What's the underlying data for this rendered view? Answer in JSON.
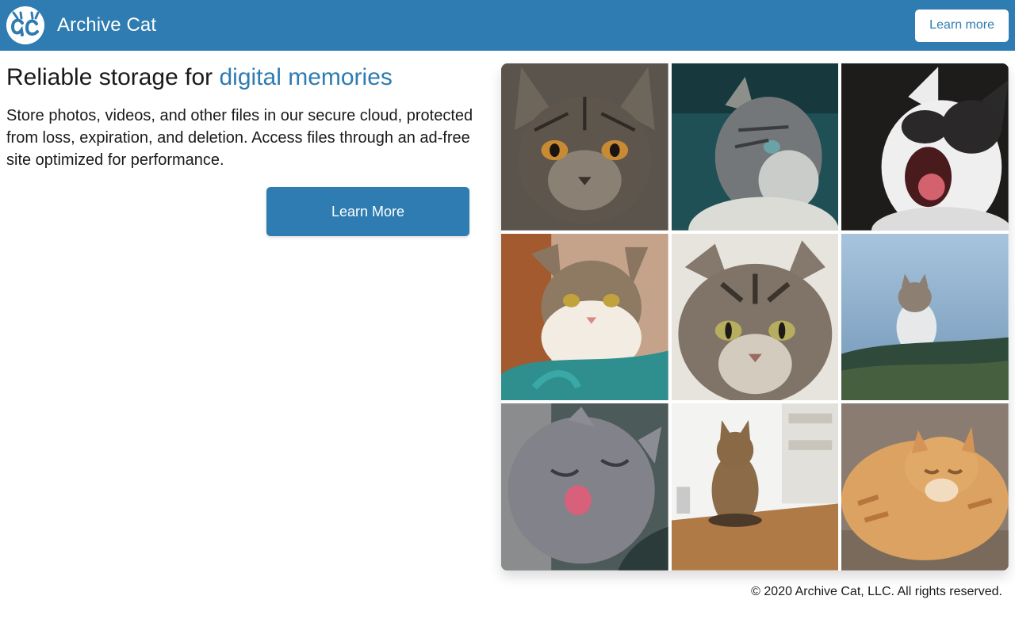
{
  "brand": {
    "name": "Archive Cat",
    "logo_icon": "archive-cat-logo-icon"
  },
  "navbar": {
    "cta_label": "Learn more",
    "background": "#2e7cb1"
  },
  "hero": {
    "headline_prefix": "Reliable storage for ",
    "headline_accent": "digital memories",
    "description": "Store photos, videos, and other files in our secure cloud, protected from loss, expiration, and deletion. Access files through an ad-free site optimized for performance.",
    "cta_label": "Learn More"
  },
  "gallery": {
    "items": [
      {
        "name": "tabby-kitten-photo"
      },
      {
        "name": "tabby-cat-profile-photo"
      },
      {
        "name": "yawning-cat-photo"
      },
      {
        "name": "tabby-kitten-on-chair-photo"
      },
      {
        "name": "tabby-cat-closeup-photo"
      },
      {
        "name": "cat-in-snow-photo"
      },
      {
        "name": "gray-cat-licking-photo"
      },
      {
        "name": "cat-on-table-photo"
      },
      {
        "name": "orange-cat-sleeping-photo"
      }
    ]
  },
  "footer": {
    "copyright": "© 2020 Archive Cat, LLC. All rights reserved."
  },
  "colors": {
    "accent": "#2e7cb1",
    "text": "#1a1a1a",
    "background": "#ffffff"
  }
}
